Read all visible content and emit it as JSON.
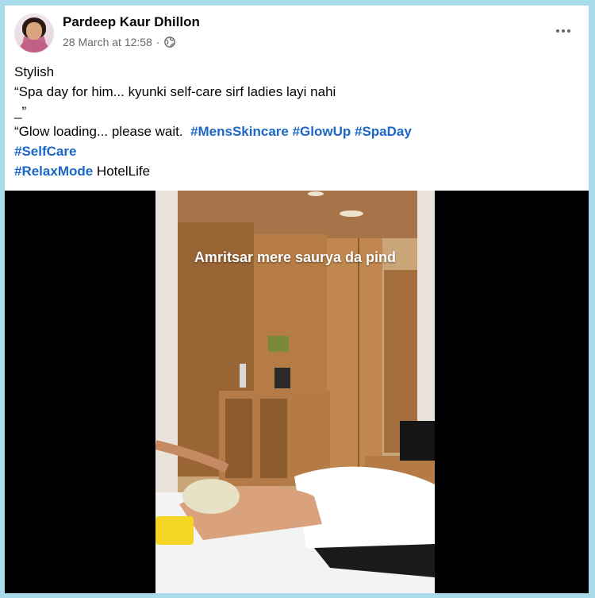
{
  "post": {
    "author": "Pardeep Kaur Dhillon",
    "timestamp": "28 March at 12:58",
    "separator": "·",
    "privacy_icon": "globe-icon",
    "more_icon": "more-options-icon"
  },
  "text": {
    "line1": "Stylish",
    "line2": "“Spa day for him... kyunki self-care sirf ladies layi nahi",
    "line3": "_”",
    "line4_prefix": "“Glow loading... please wait.  ",
    "hashtags_line4": [
      "#MensSkincare",
      "#GlowUp",
      "#SpaDay"
    ],
    "hashtag_line5": "#SelfCare",
    "hashtag_line6": "#RelaxMode",
    "line6_suffix": " HotelLife"
  },
  "video": {
    "caption": "Amritsar mere saurya da pind"
  },
  "colors": {
    "background": "#a9dcea",
    "hashtag": "#1b67c8",
    "meta": "#65676b"
  }
}
